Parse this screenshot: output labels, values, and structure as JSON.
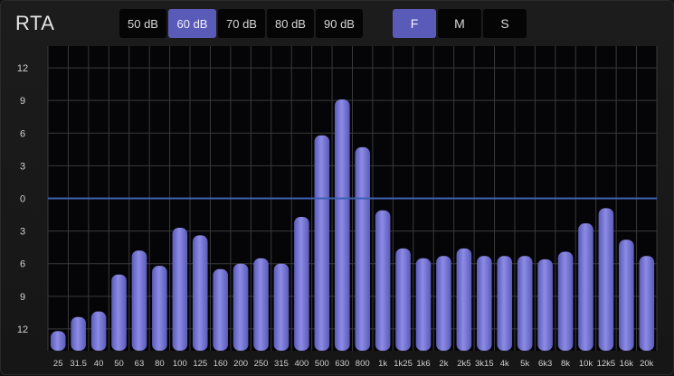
{
  "header": {
    "title": "RTA",
    "db_buttons": [
      {
        "label": "50 dB",
        "active": false
      },
      {
        "label": "60 dB",
        "active": true
      },
      {
        "label": "70 dB",
        "active": false
      },
      {
        "label": "80 dB",
        "active": false
      },
      {
        "label": "90 dB",
        "active": false
      }
    ],
    "mode_buttons": [
      {
        "label": "F",
        "active": true
      },
      {
        "label": "M",
        "active": false
      },
      {
        "label": "S",
        "active": false
      }
    ]
  },
  "colors": {
    "bar": "#5a5ab8",
    "bar_highlight": "#8c8ce6",
    "zero_line": "#3f5fb0",
    "grid": "#3a3a3a",
    "plot_bg": "#050507",
    "active_button": "#5a5ab8"
  },
  "chart_data": {
    "type": "bar",
    "title": "",
    "xlabel": "",
    "ylabel": "",
    "ylim": [
      -14,
      14
    ],
    "y_ticks": [
      {
        "value": 12,
        "label": "12"
      },
      {
        "value": 9,
        "label": "9"
      },
      {
        "value": 6,
        "label": "6"
      },
      {
        "value": 3,
        "label": "3"
      },
      {
        "value": 0,
        "label": "0"
      },
      {
        "value": -3,
        "label": "3"
      },
      {
        "value": -6,
        "label": "6"
      },
      {
        "value": -9,
        "label": "9"
      },
      {
        "value": -12,
        "label": "12"
      }
    ],
    "reference_line": 0,
    "grid": true,
    "categories": [
      "25",
      "31.5",
      "40",
      "50",
      "63",
      "80",
      "100",
      "125",
      "160",
      "200",
      "250",
      "315",
      "400",
      "500",
      "630",
      "800",
      "1k",
      "1k25",
      "1k6",
      "2k",
      "2k5",
      "3k15",
      "4k",
      "5k",
      "6k3",
      "8k",
      "10k",
      "12k5",
      "16k",
      "20k"
    ],
    "values": [
      -12.2,
      -10.9,
      -10.4,
      -7.0,
      -4.8,
      -6.2,
      -2.7,
      -3.4,
      -6.5,
      -6.0,
      -5.5,
      -6.0,
      -1.7,
      5.8,
      9.1,
      4.7,
      -1.1,
      -4.6,
      -5.5,
      -5.3,
      -4.6,
      -5.3,
      -5.3,
      -5.3,
      -5.6,
      -4.9,
      -2.3,
      -0.9,
      -3.8,
      -5.3
    ]
  }
}
